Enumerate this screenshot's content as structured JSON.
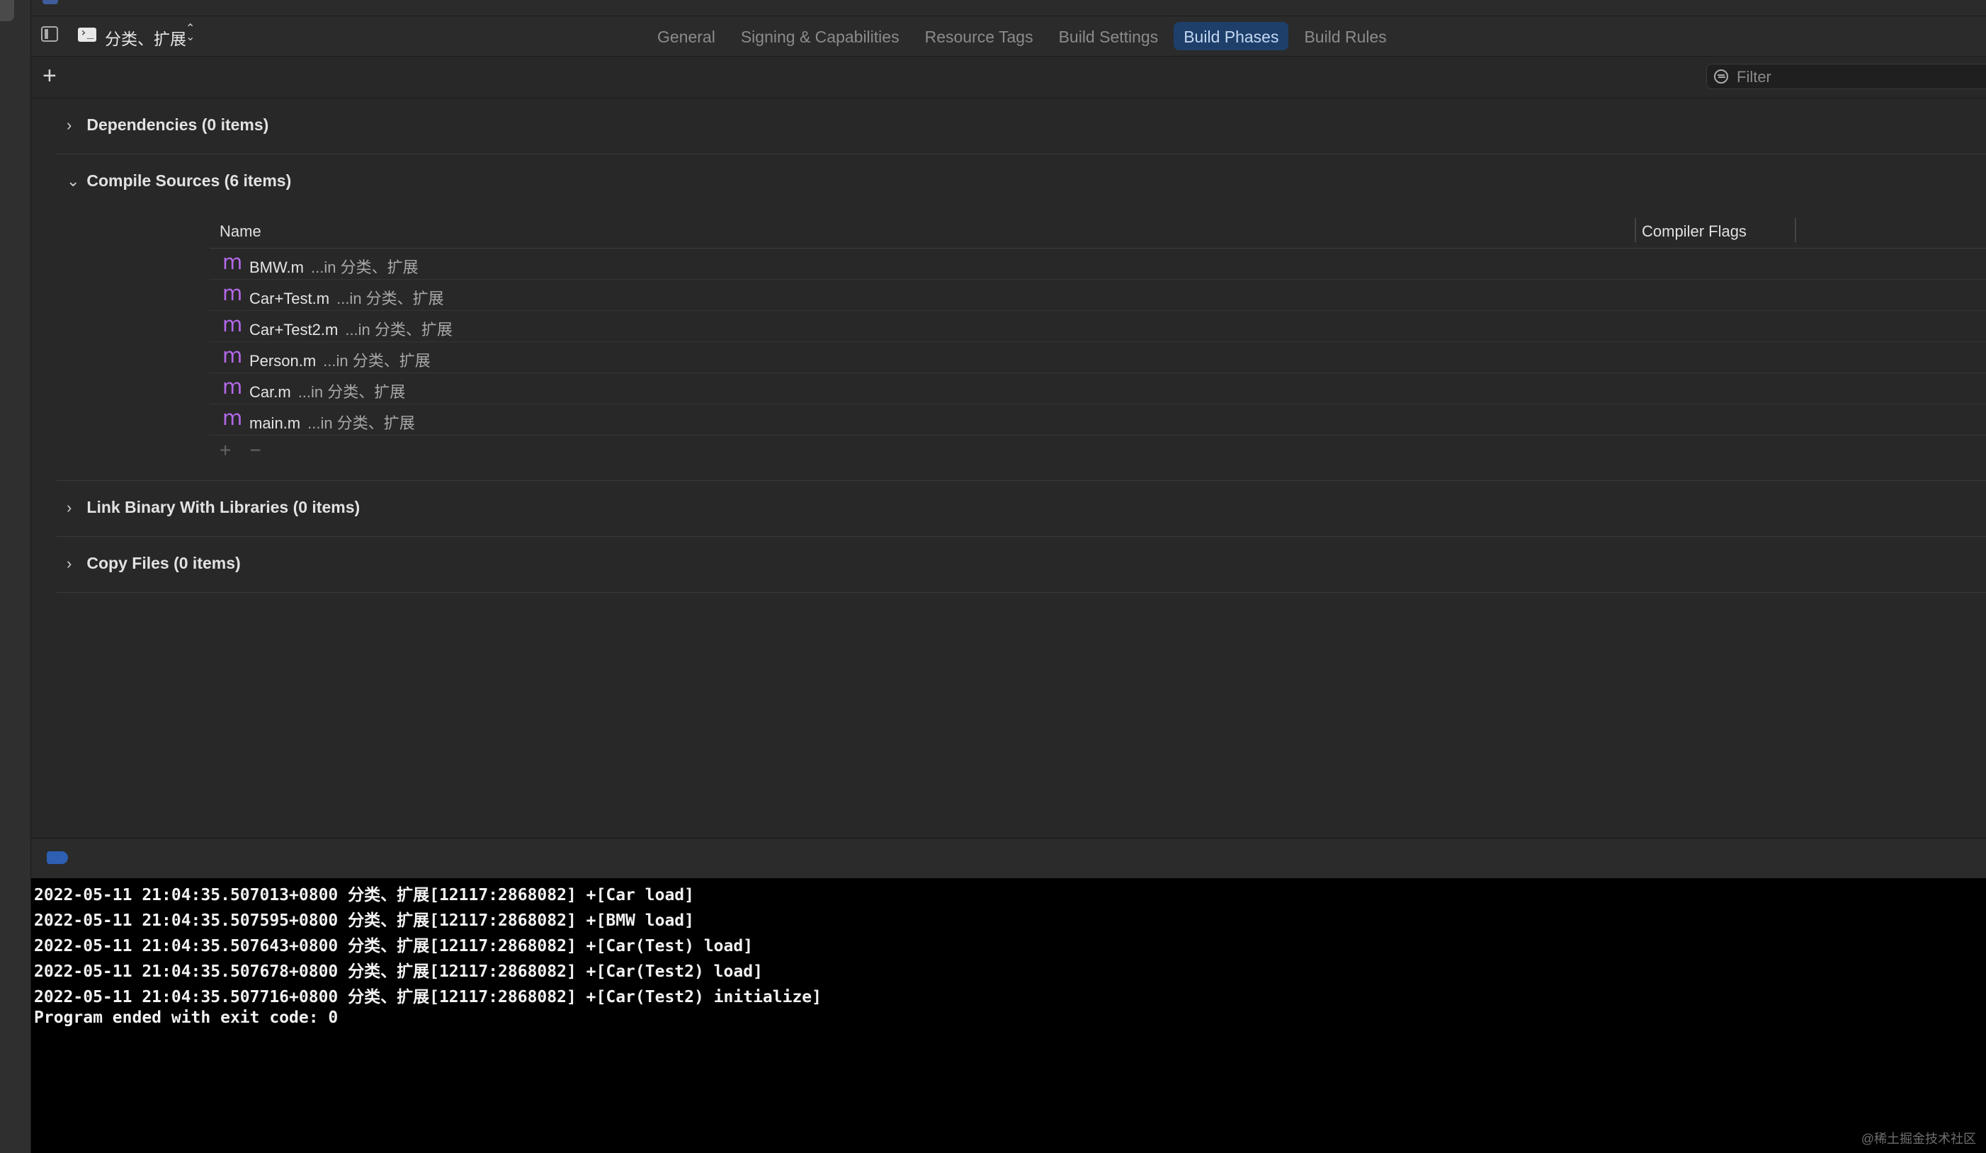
{
  "header": {
    "target_name": "分类、扩展",
    "tabs": [
      {
        "label": "General",
        "active": false
      },
      {
        "label": "Signing & Capabilities",
        "active": false
      },
      {
        "label": "Resource Tags",
        "active": false
      },
      {
        "label": "Build Settings",
        "active": false
      },
      {
        "label": "Build Phases",
        "active": true
      },
      {
        "label": "Build Rules",
        "active": false
      }
    ]
  },
  "toolbar": {
    "filter_placeholder": "Filter"
  },
  "phases": {
    "dependencies": "Dependencies (0 items)",
    "compile_sources": "Compile Sources (6 items)",
    "link_binary": "Link Binary With Libraries (0 items)",
    "copy_files": "Copy Files (0 items)"
  },
  "compile_table": {
    "col_name": "Name",
    "col_flags": "Compiler Flags",
    "rows": [
      {
        "file": "BMW.m",
        "location": "...in 分类、扩展"
      },
      {
        "file": "Car+Test.m",
        "location": "...in 分类、扩展"
      },
      {
        "file": "Car+Test2.m",
        "location": "...in 分类、扩展"
      },
      {
        "file": "Person.m",
        "location": "...in 分类、扩展"
      },
      {
        "file": "Car.m",
        "location": "...in 分类、扩展"
      },
      {
        "file": "main.m",
        "location": "...in 分类、扩展"
      }
    ],
    "file_icon_glyph": "m"
  },
  "console": {
    "lines": [
      "2022-05-11 21:04:35.507013+0800 分类、扩展[12117:2868082] +[Car load]",
      "2022-05-11 21:04:35.507595+0800 分类、扩展[12117:2868082] +[BMW load]",
      "2022-05-11 21:04:35.507643+0800 分类、扩展[12117:2868082] +[Car(Test) load]",
      "2022-05-11 21:04:35.507678+0800 分类、扩展[12117:2868082] +[Car(Test2) load]",
      "2022-05-11 21:04:35.507716+0800 分类、扩展[12117:2868082] +[Car(Test2) initialize]",
      "Program ended with exit code: 0"
    ]
  },
  "watermark": "@稀土掘金技术社区",
  "colors": {
    "accent_tab": "#1e3f6a",
    "file_icon": "#b368e8",
    "console_bg": "#000000"
  }
}
